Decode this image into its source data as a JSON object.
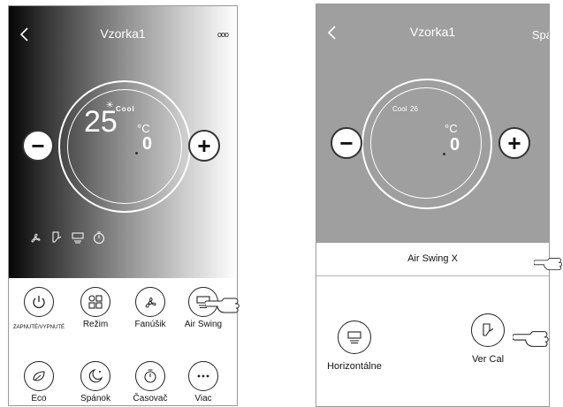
{
  "left_screen": {
    "title": "Vzorka1",
    "more_label": "ooo",
    "temperature": "25",
    "mode_label": "Cool",
    "unit": "°C",
    "decimal": "0",
    "minus_label": "−",
    "plus_label": "+",
    "status_icons": [
      "fan-icon",
      "vertical-swing-icon",
      "horizontal-swing-icon",
      "timer-icon"
    ],
    "functions": [
      {
        "label": "ZAPNUTÉ/VYPNUTÉ",
        "icon": "power-icon"
      },
      {
        "label": "Režim",
        "icon": "mode-icon"
      },
      {
        "label": "Fanúšik",
        "icon": "fan-icon"
      },
      {
        "label": "Air Swing",
        "icon": "air-swing-icon"
      },
      {
        "label": "Eco",
        "icon": "eco-leaf-icon"
      },
      {
        "label": "Spánok",
        "icon": "sleep-icon"
      },
      {
        "label": "Časovač",
        "icon": "timer-icon"
      },
      {
        "label": "Viac",
        "icon": "more-dots-icon"
      }
    ]
  },
  "right_screen": {
    "title": "Vzorka1",
    "right_label": "Spá",
    "mode_label": "Cool",
    "temperature_small": "26",
    "unit": "°C",
    "decimal": "0",
    "minus_label": "−",
    "plus_label": "+",
    "bar_label": "Air Swing X",
    "options": [
      {
        "label": "Horizontálne",
        "icon": "horizontal-swing-icon"
      },
      {
        "label": "Ver Cal",
        "icon": "vertical-swing-icon"
      }
    ]
  },
  "colors": {
    "right_top_background": "#9f9f9f",
    "text_on_dark": "#ffffff"
  }
}
